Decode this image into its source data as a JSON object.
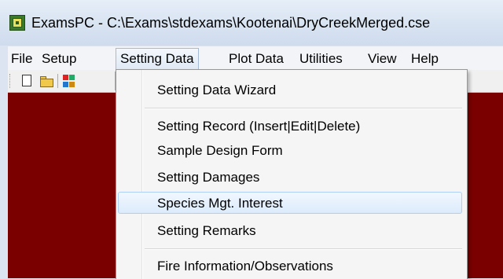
{
  "window": {
    "title": "ExamsPC - C:\\Exams\\stdexams\\Kootenai\\DryCreekMerged.cse",
    "icon": "app-logo-icon"
  },
  "menubar": {
    "items": [
      "File",
      "Setup",
      "Setting Data",
      "Plot Data",
      "Utilities",
      "View",
      "Help"
    ],
    "active": "Setting Data"
  },
  "toolbar": {
    "buttons": [
      "new-document-icon",
      "open-folder-icon",
      "swap-icon"
    ]
  },
  "dropdown": {
    "items": [
      "Setting Data Wizard",
      "Setting Record (Insert|Edit|Delete)",
      "Sample Design Form",
      "Setting Damages",
      "Species Mgt. Interest",
      "Setting Remarks",
      "Fire Information/Observations"
    ],
    "highlighted": "Species Mgt. Interest"
  },
  "colors": {
    "workspace": "#7a0000",
    "highlight_border": "#aecff7"
  }
}
